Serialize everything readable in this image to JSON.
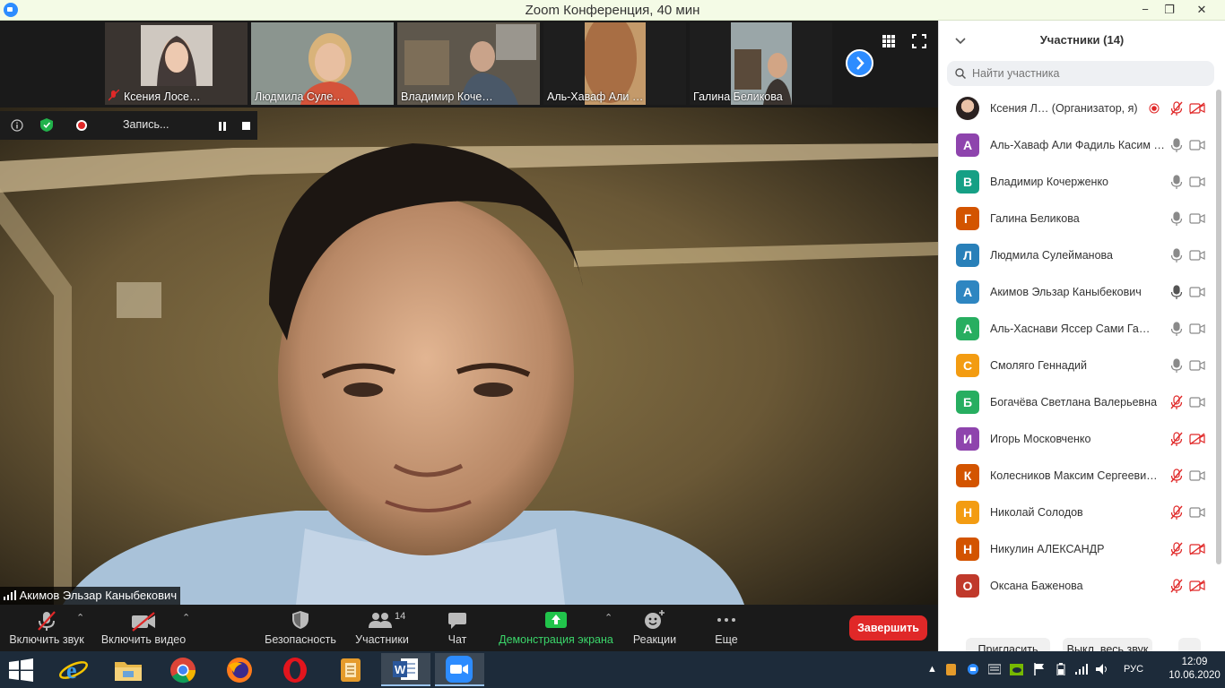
{
  "window": {
    "title": "Zoom Конференция, 40 мин",
    "minimize_glyph": "−",
    "restore_glyph": "❐",
    "close_glyph": "✕"
  },
  "thumbnails": [
    {
      "name": "Ксения Лосе…",
      "muted": true
    },
    {
      "name": "Людмила Суле…",
      "muted": false
    },
    {
      "name": "Владимир Коче…",
      "muted": false
    },
    {
      "name": "Аль-Хаваф Али …",
      "muted": false
    },
    {
      "name": "Галина Беликова",
      "muted": false
    }
  ],
  "recording": {
    "label": "Запись..."
  },
  "speaker": {
    "name": "Акимов Эльзар Каныбекович"
  },
  "toolbar": {
    "unmute": "Включить звук",
    "start_video": "Включить видео",
    "security": "Безопасность",
    "participants": "Участники",
    "participants_count": "14",
    "chat": "Чат",
    "share": "Демонстрация экрана",
    "reactions": "Реакции",
    "more": "Еще",
    "end": "Завершить"
  },
  "panel": {
    "title": "Участники (14)",
    "search_placeholder": "Найти участника",
    "invite": "Пригласить",
    "mute_all": "Выкл. весь звук",
    "more": "...",
    "participants": [
      {
        "name": "Ксения Л… (Организатор, я)",
        "initial": "",
        "color": "#7a6a5a",
        "mic": "muted",
        "cam": "off",
        "host": true
      },
      {
        "name": "Аль-Хаваф Али Фадиль Касим …",
        "initial": "А",
        "color": "#8e44ad",
        "mic": "on",
        "cam": "on"
      },
      {
        "name": "Владимир Кочерженко",
        "initial": "В",
        "color": "#16a085",
        "mic": "on",
        "cam": "on"
      },
      {
        "name": "Галина Беликова",
        "initial": "Г",
        "color": "#d35400",
        "mic": "on",
        "cam": "on"
      },
      {
        "name": "Людмила Сулейманова",
        "initial": "Л",
        "color": "#2980b9",
        "mic": "on",
        "cam": "on"
      },
      {
        "name": "Акимов Эльзар Каныбекович",
        "initial": "А",
        "color": "#2e86c1",
        "mic": "active",
        "cam": "on"
      },
      {
        "name": "Аль-Хаснави Яссер Сами Га…",
        "initial": "А",
        "color": "#27ae60",
        "mic": "on",
        "cam": "on"
      },
      {
        "name": "Смоляго Геннадий",
        "initial": "С",
        "color": "#f39c12",
        "mic": "on",
        "cam": "on"
      },
      {
        "name": "Богачёва Светлана Валерьевна",
        "initial": "Б",
        "color": "#27ae60",
        "mic": "muted",
        "cam": "on"
      },
      {
        "name": "Игорь Московченко",
        "initial": "И",
        "color": "#8e44ad",
        "mic": "muted",
        "cam": "off"
      },
      {
        "name": "Колесников Максим Сергееви…",
        "initial": "К",
        "color": "#d35400",
        "mic": "muted",
        "cam": "on"
      },
      {
        "name": "Николай Солодов",
        "initial": "Н",
        "color": "#f39c12",
        "mic": "muted",
        "cam": "on"
      },
      {
        "name": "Никулин АЛЕКСАНДР",
        "initial": "Н",
        "color": "#d35400",
        "mic": "muted",
        "cam": "off"
      },
      {
        "name": "Оксана Баженова",
        "initial": "О",
        "color": "#c0392b",
        "mic": "muted",
        "cam": "off"
      }
    ]
  },
  "taskbar": {
    "lang": "РУС",
    "time": "12:09",
    "date": "10.06.2020"
  }
}
